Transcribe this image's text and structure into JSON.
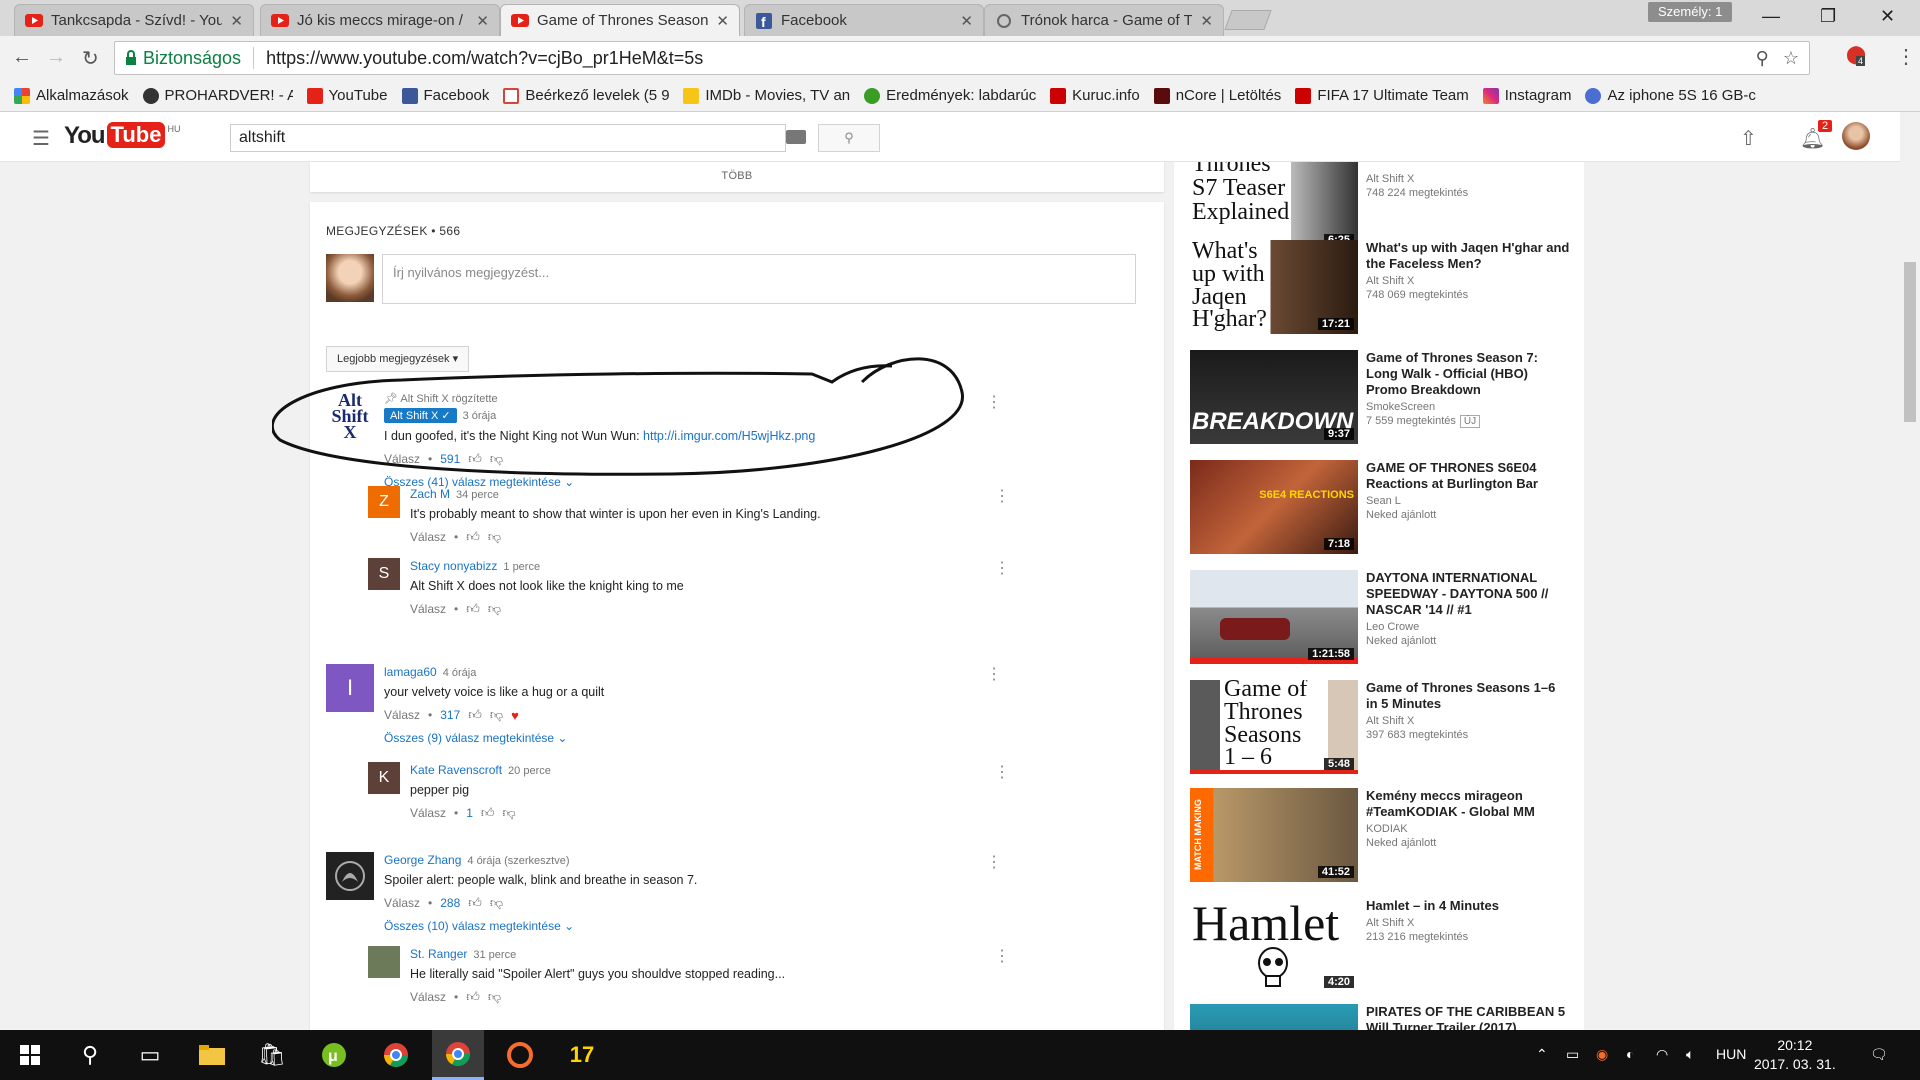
{
  "browser": {
    "tabs": [
      {
        "title": "Tankcsapda - Szívd! - You",
        "favicon": "youtube-icon",
        "active": false
      },
      {
        "title": "Jó kis meccs mirage-on /",
        "favicon": "youtube-icon",
        "active": false
      },
      {
        "title": "Game of Thrones Season",
        "favicon": "youtube-icon",
        "active": true
      },
      {
        "title": "Facebook",
        "favicon": "facebook-icon",
        "active": false
      },
      {
        "title": "Trónok harca - Game of T",
        "favicon": "loading-icon",
        "active": false
      }
    ],
    "profile_label": "Személy: 1",
    "secure_label": "Biztonságos",
    "url": "https://www.youtube.com/watch?v=cjBo_pr1HeM&t=5s",
    "extension_badge": "4",
    "bookmarks": [
      "Alkalmazások",
      "PROHARDVER! - Az O",
      "YouTube",
      "Facebook",
      "Beérkező levelek (5 90",
      "IMDb - Movies, TV an",
      "Eredmények: labdarúc",
      "Kuruc.info",
      "nCore | Letöltés",
      "FIFA 17 Ultimate Team",
      "Instagram",
      "Az iphone 5S 16 GB-c"
    ]
  },
  "youtube": {
    "logo_you": "You",
    "logo_tube": "Tube",
    "country": "HU",
    "search_value": "altshift",
    "notification_count": "2",
    "more_label": "TÖBB",
    "comments_header": "MEGJEGYZÉSEK • 566",
    "comment_placeholder": "Írj nyilvános megjegyzést...",
    "sort_label": "Legjobb megjegyzések ▾",
    "reply_label": "Válasz"
  },
  "comments": {
    "c1": {
      "pinned": "Alt Shift X rögzítette",
      "avatar_text": "Alt\nShift\nX",
      "author": "Alt Shift X ✓",
      "time": "3 órája",
      "text": "I dun goofed, it's the Night King not Wun Wun: ",
      "link": "http://i.imgur.com/H5wjHkz.png",
      "likes": "591",
      "view_replies": "Összes (41) válasz megtekintése ⌄"
    },
    "r1": {
      "avatar_letter": "Z",
      "author": "Zach M",
      "time": "34 perce",
      "text": "It's probably meant to show that winter is upon her even in King's Landing."
    },
    "r2": {
      "avatar_letter": "S",
      "author": "Stacy nonyabizz",
      "time": "1 perce",
      "text": "Alt Shift X  does not look like the knight king to me"
    },
    "c2": {
      "avatar_letter": "I",
      "author": "lamaga60",
      "time": "4 órája",
      "text": "your velvety voice is like a hug or a quilt",
      "likes": "317",
      "view_replies": "Összes (9) válasz megtekintése ⌄"
    },
    "r3": {
      "avatar_letter": "K",
      "author": "Kate Ravenscroft",
      "time": "20 perce",
      "text": "pepper pig",
      "likes": "1"
    },
    "c3": {
      "author": "George Zhang",
      "time": "4 órája (szerkesztve)",
      "text": "Spoiler alert: people walk, blink and breathe in season 7.",
      "likes": "288",
      "view_replies": "Összes (10) válasz megtekintése ⌄"
    },
    "r4": {
      "author": "St. Ranger",
      "time": "31 perce",
      "text": "He literally said \"Spoiler Alert\" guys you shouldve stopped reading..."
    }
  },
  "sidebar": [
    {
      "thumb_text": "Thrones\nS7 Teaser\nExplained",
      "duration": "6:25",
      "title": "",
      "channel": "Alt Shift X",
      "meta": "748 224 megtekintés"
    },
    {
      "thumb_text": "What's\nup with\nJaqen\nH'ghar?",
      "duration": "17:21",
      "title": "What's up with Jaqen H'ghar and the Faceless Men?",
      "channel": "Alt Shift X",
      "meta": "748 069 megtekintés"
    },
    {
      "thumb_text": "BREAKDOWN",
      "duration": "9:37",
      "title": "Game of Thrones Season 7: Long Walk - Official (HBO) Promo Breakdown",
      "channel": "SmokeScreen",
      "meta": "7 559 megtekintés",
      "tag": "ÚJ"
    },
    {
      "thumb_text": "S6E4 REACTIONS\nAT BURLINGTON",
      "duration": "7:18",
      "title": "GAME OF THRONES S6E04 Reactions at Burlington Bar",
      "channel": "Sean L",
      "meta": "Neked ajánlott"
    },
    {
      "thumb_text": "",
      "duration": "1:21:58",
      "title": "DAYTONA INTERNATIONAL SPEEDWAY - DAYTONA 500 // NASCAR '14 // #1",
      "channel": "Leo Crowe",
      "meta": "Neked ajánlott"
    },
    {
      "thumb_text": "Game of\nThrones\nSeasons\n1 – 6",
      "duration": "5:48",
      "title": "Game of Thrones Seasons 1–6 in 5 Minutes",
      "channel": "Alt Shift X",
      "meta": "397 683 megtekintés"
    },
    {
      "thumb_text": "MATCH MAKING",
      "duration": "41:52",
      "title": "Kemény meccs mirageon #TeamKODIAK - Global MM",
      "channel": "KODIAK",
      "meta": "Neked ajánlott"
    },
    {
      "thumb_text": "Hamlet",
      "duration": "4:20",
      "title": "Hamlet – in 4 Minutes",
      "channel": "Alt Shift X",
      "meta": "213 216 megtekintés"
    },
    {
      "thumb_text": "",
      "duration": "",
      "title": "PIRATES OF THE CARIBBEAN 5 Will Turner Trailer (2017)",
      "channel": "",
      "meta": ""
    }
  ],
  "taskbar": {
    "lang": "HUN",
    "time": "20:12",
    "date": "2017. 03. 31."
  },
  "colors": {
    "youtube_red": "#e62117",
    "link_blue": "#1a73c7",
    "secure_green": "#0b8043"
  }
}
